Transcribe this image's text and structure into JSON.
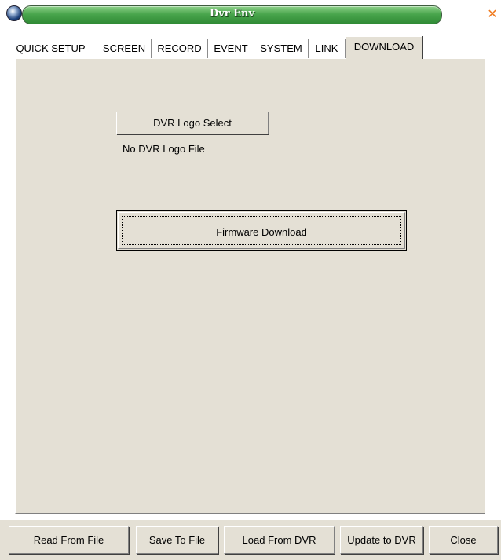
{
  "window": {
    "title": "Dvr Env",
    "close_glyph": "✕"
  },
  "tabs": [
    {
      "label": "QUICK SETUP",
      "active": false
    },
    {
      "label": "SCREEN",
      "active": false
    },
    {
      "label": "RECORD",
      "active": false
    },
    {
      "label": "EVENT",
      "active": false
    },
    {
      "label": "SYSTEM",
      "active": false
    },
    {
      "label": "LINK",
      "active": false
    },
    {
      "label": "DOWNLOAD",
      "active": true
    }
  ],
  "download": {
    "logo_button_label": "DVR Logo Select",
    "logo_status": "No DVR Logo File",
    "firmware_button_label": "Firmware Download"
  },
  "bottom_buttons": {
    "read": "Read From File",
    "save": "Save To File",
    "load": "Load From DVR",
    "update": "Update to DVR",
    "close": "Close"
  },
  "colors": {
    "panel_bg": "#e4e0d5",
    "title_green": "#4aa64d",
    "close_orange": "#f07a1e"
  }
}
